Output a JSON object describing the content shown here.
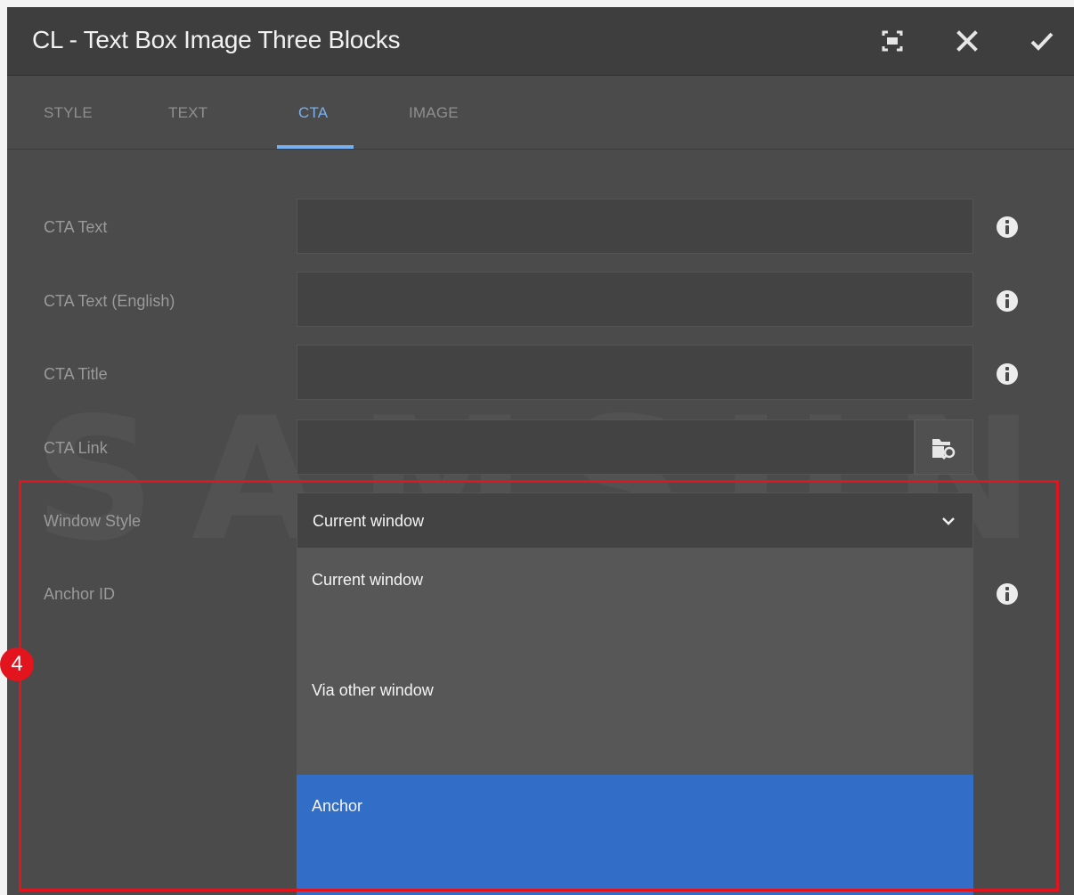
{
  "dialog": {
    "title": "CL - Text Box Image Three Blocks",
    "buttons": {
      "fullscreen_icon": "fullscreen-icon",
      "close_icon": "close-icon",
      "confirm_icon": "checkmark-icon"
    }
  },
  "tabs": [
    {
      "label": "STYLE",
      "active": false
    },
    {
      "label": "TEXT",
      "active": false
    },
    {
      "label": "CTA",
      "active": true
    },
    {
      "label": "IMAGE",
      "active": false
    }
  ],
  "form": {
    "cta_text": {
      "label": "CTA Text",
      "value": ""
    },
    "cta_text_english": {
      "label": "CTA Text (English)",
      "value": ""
    },
    "cta_title": {
      "label": "CTA Title",
      "value": ""
    },
    "cta_link": {
      "label": "CTA Link",
      "value": ""
    },
    "window_style": {
      "label": "Window Style",
      "selected": "Current window",
      "options": [
        "Current window",
        "Via other window",
        "Anchor"
      ],
      "highlighted_option": "Anchor"
    },
    "anchor_id": {
      "label": "Anchor ID",
      "value": ""
    }
  },
  "annotation": {
    "step": "4",
    "color": "#e3141d"
  },
  "colors": {
    "accent": "#78b0f4",
    "selected_option": "#326ec8",
    "background": "#4b4b4b"
  }
}
